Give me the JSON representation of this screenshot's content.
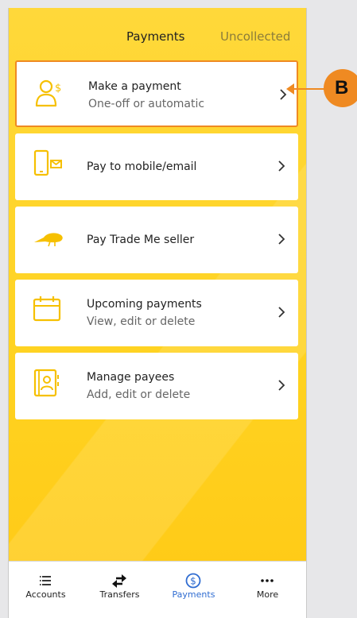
{
  "tabs": {
    "payments_label": "Payments",
    "uncollected_label": "Uncollected"
  },
  "menu": {
    "items": [
      {
        "title": "Make a payment",
        "subtitle": "One-off or automatic",
        "icon": "person-dollar-icon"
      },
      {
        "title": "Pay to mobile/email",
        "subtitle": "",
        "icon": "phone-email-icon"
      },
      {
        "title": "Pay Trade Me seller",
        "subtitle": "",
        "icon": "kiwi-bird-icon"
      },
      {
        "title": "Upcoming payments",
        "subtitle": "View, edit or delete",
        "icon": "calendar-icon"
      },
      {
        "title": "Manage payees",
        "subtitle": "Add, edit or delete",
        "icon": "contacts-book-icon"
      }
    ]
  },
  "bottom_nav": {
    "items": [
      {
        "label": "Accounts",
        "icon": "list-icon"
      },
      {
        "label": "Transfers",
        "icon": "transfer-arrows-icon"
      },
      {
        "label": "Payments",
        "icon": "dollar-circle-icon",
        "active": true
      },
      {
        "label": "More",
        "icon": "more-dots-icon"
      }
    ]
  },
  "annotation": {
    "badge_label": "B"
  },
  "colors": {
    "background_yellow": "#ffd322",
    "icon_yellow": "#f6c000",
    "highlight_orange": "#ef8a22",
    "active_blue": "#2f6cd1"
  }
}
